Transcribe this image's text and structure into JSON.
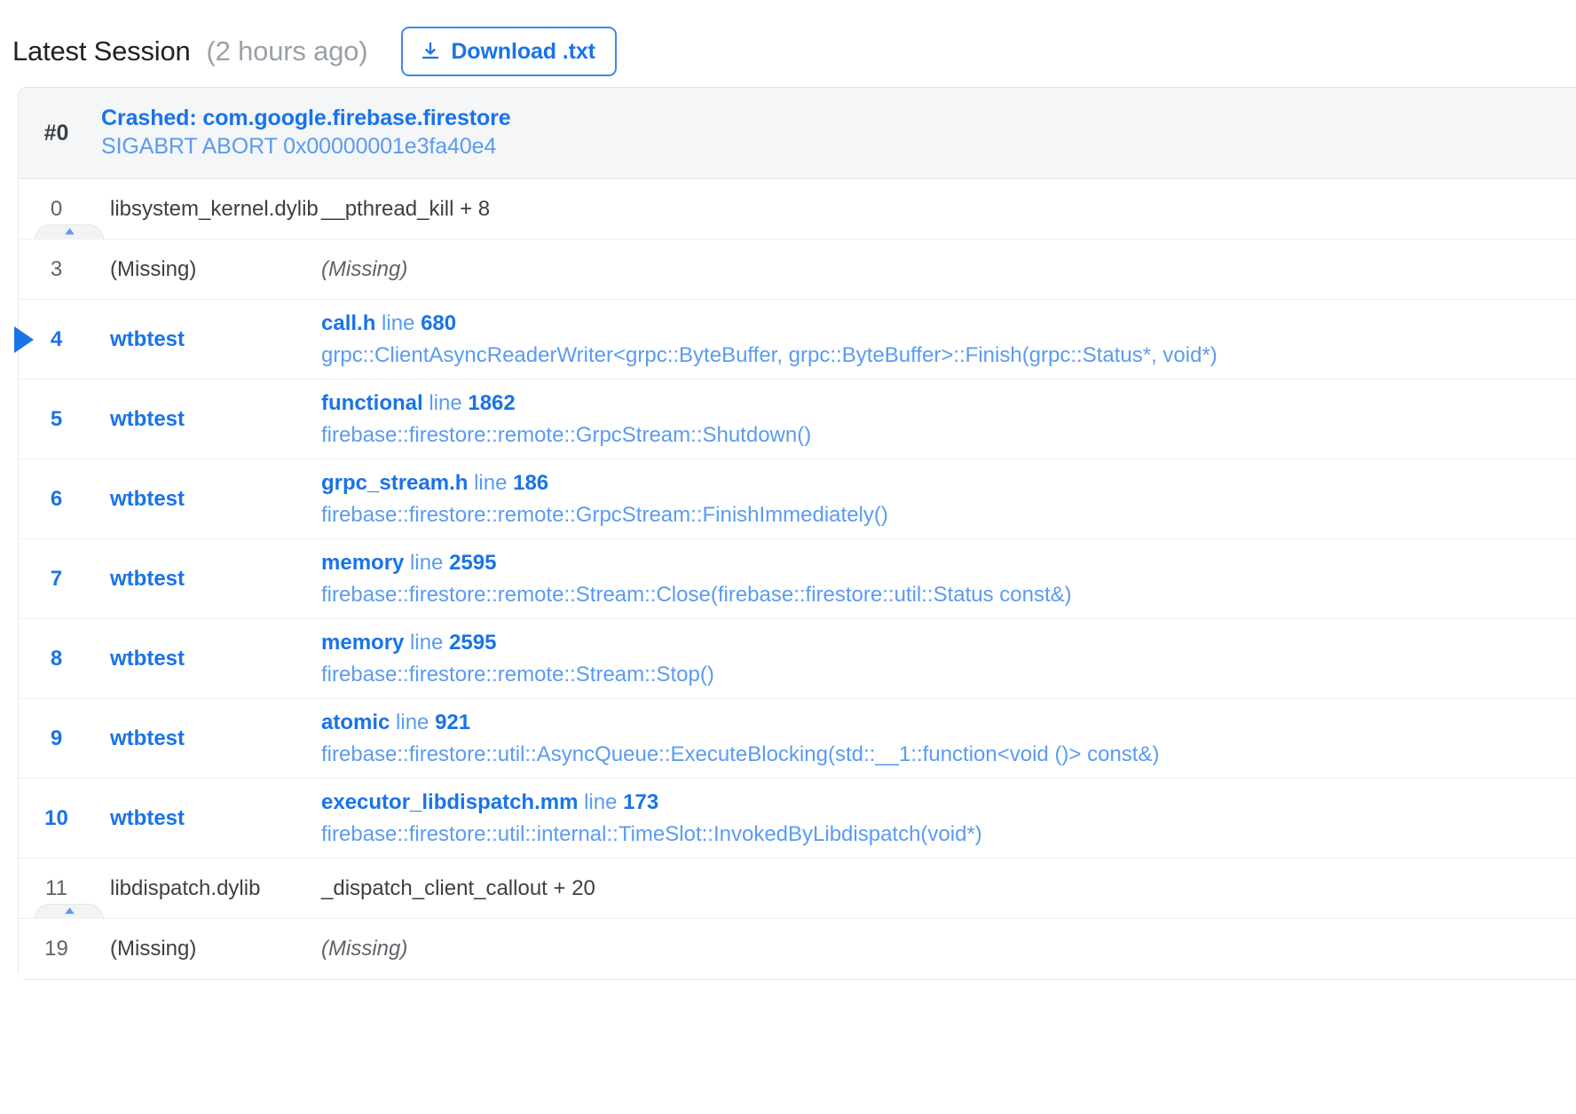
{
  "header": {
    "title": "Latest Session",
    "age": "(2 hours ago)",
    "download_label": "Download .txt",
    "download_icon": "download-icon"
  },
  "colors": {
    "link_blue": "#1a73e8",
    "light_blue": "#5b9bf0",
    "header_bg": "#f4f6f8",
    "border": "#e3e7eb",
    "text": "#3c4043",
    "muted": "#5f6368"
  },
  "crash": {
    "index": "#0",
    "title": "Crashed: com.google.firebase.firestore",
    "subtitle": "SIGABRT ABORT 0x00000001e3fa40e4"
  },
  "frames": [
    {
      "kind": "system",
      "index": "0",
      "library": "libsystem_kernel.dylib",
      "symbol": "__pthread_kill + 8",
      "italic": false
    },
    {
      "kind": "expander",
      "icon": "expand-collapse-icon"
    },
    {
      "kind": "system",
      "index": "3",
      "library": "(Missing)",
      "symbol": "(Missing)",
      "italic": true
    },
    {
      "kind": "app",
      "selected": true,
      "index": "4",
      "library": "wtbtest",
      "file": "call.h",
      "line_kw": "line",
      "line": "680",
      "signature": "grpc::ClientAsyncReaderWriter<grpc::ByteBuffer, grpc::ByteBuffer>::Finish(grpc::Status*, void*)"
    },
    {
      "kind": "app",
      "selected": false,
      "index": "5",
      "library": "wtbtest",
      "file": "functional",
      "line_kw": "line",
      "line": "1862",
      "signature": "firebase::firestore::remote::GrpcStream::Shutdown()"
    },
    {
      "kind": "app",
      "selected": false,
      "index": "6",
      "library": "wtbtest",
      "file": "grpc_stream.h",
      "line_kw": "line",
      "line": "186",
      "signature": "firebase::firestore::remote::GrpcStream::FinishImmediately()"
    },
    {
      "kind": "app",
      "selected": false,
      "index": "7",
      "library": "wtbtest",
      "file": "memory",
      "line_kw": "line",
      "line": "2595",
      "signature": "firebase::firestore::remote::Stream::Close(firebase::firestore::util::Status const&)"
    },
    {
      "kind": "app",
      "selected": false,
      "index": "8",
      "library": "wtbtest",
      "file": "memory",
      "line_kw": "line",
      "line": "2595",
      "signature": "firebase::firestore::remote::Stream::Stop()"
    },
    {
      "kind": "app",
      "selected": false,
      "index": "9",
      "library": "wtbtest",
      "file": "atomic",
      "line_kw": "line",
      "line": "921",
      "signature": "firebase::firestore::util::AsyncQueue::ExecuteBlocking(std::__1::function<void ()> const&)"
    },
    {
      "kind": "app",
      "selected": false,
      "index": "10",
      "library": "wtbtest",
      "file": "executor_libdispatch.mm",
      "line_kw": "line",
      "line": "173",
      "signature": "firebase::firestore::util::internal::TimeSlot::InvokedByLibdispatch(void*)"
    },
    {
      "kind": "system",
      "index": "11",
      "library": "libdispatch.dylib",
      "symbol": "_dispatch_client_callout + 20",
      "italic": false
    },
    {
      "kind": "expander",
      "icon": "expand-collapse-icon"
    },
    {
      "kind": "system",
      "index": "19",
      "library": "(Missing)",
      "symbol": "(Missing)",
      "italic": true
    }
  ]
}
